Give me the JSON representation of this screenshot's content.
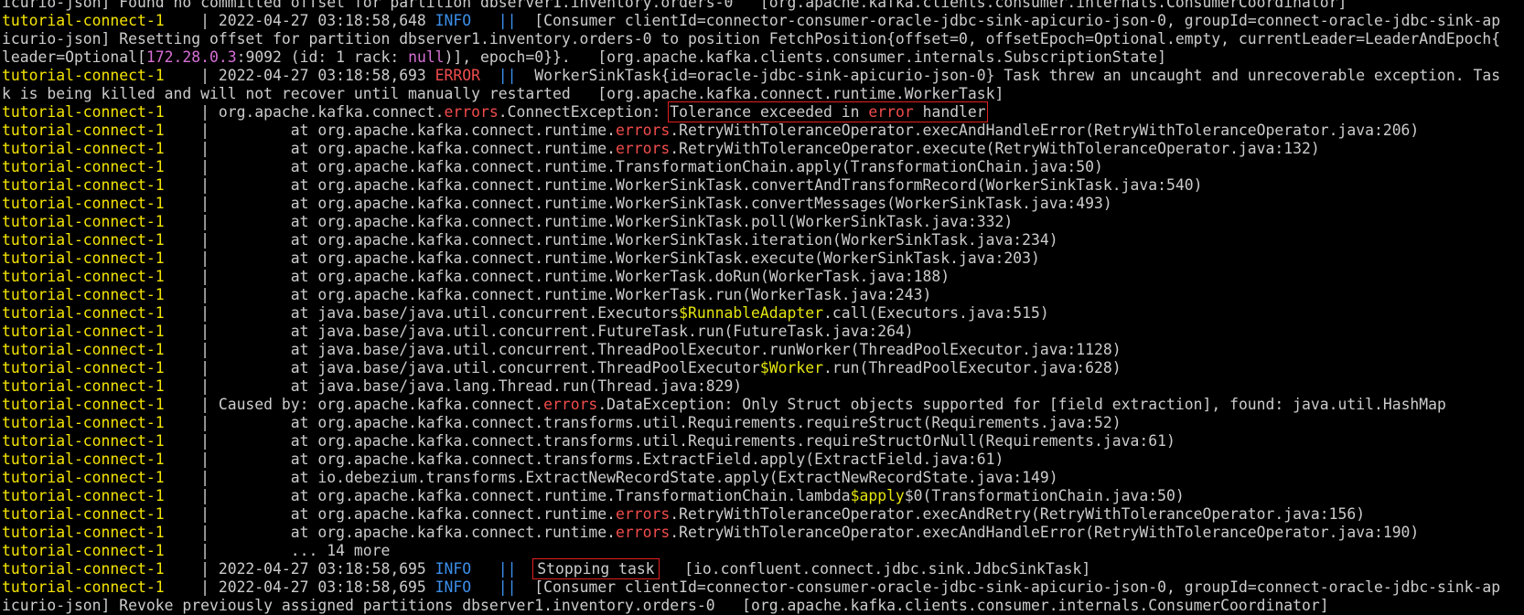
{
  "terminal": {
    "colors": {
      "background": "#000000",
      "text": "#cccccc",
      "container_prefix": "#f5e400",
      "info": "#3b8eea",
      "error": "#f14c4c",
      "magenta": "#d670d6",
      "class_yellow": "#e5e510",
      "highlight_box": "#e02020"
    },
    "lines": [
      {
        "segs": [
          {
            "t": "icurio-json] Found no committed offset for partition dbserver1.inventory.orders-0   [org.apache.kafka.clients.consumer.internals.ConsumerCoordinator]",
            "c": "default"
          }
        ]
      },
      {
        "segs": [
          {
            "t": "tutorial-connect-1",
            "c": "container"
          },
          {
            "t": "    | 2022-04-27 03:18:58,648 ",
            "c": "default"
          },
          {
            "t": "INFO",
            "c": "info"
          },
          {
            "t": "   ",
            "c": "default"
          },
          {
            "t": "||",
            "c": "info"
          },
          {
            "t": "  [Consumer clientId=connector-consumer-oracle-jdbc-sink-apicurio-json-0, groupId=connect-oracle-jdbc-sink-ap",
            "c": "default"
          }
        ]
      },
      {
        "segs": [
          {
            "t": "icurio-json] Resetting offset for partition dbserver1.inventory.orders-0 to position FetchPosition{offset=0, offsetEpoch=Optional.empty, currentLeader=LeaderAndEpoch{",
            "c": "default"
          }
        ]
      },
      {
        "segs": [
          {
            "t": "leader=Optional[",
            "c": "default"
          },
          {
            "t": "172.28.0.3",
            "c": "magenta"
          },
          {
            "t": ":9092 (id: 1 rack: ",
            "c": "default"
          },
          {
            "t": "null",
            "c": "magenta"
          },
          {
            "t": ")], epoch=0}}.   [org.apache.kafka.clients.consumer.internals.SubscriptionState]",
            "c": "default"
          }
        ]
      },
      {
        "segs": [
          {
            "t": "tutorial-connect-1",
            "c": "container"
          },
          {
            "t": "    | 2022-04-27 03:18:58,693 ",
            "c": "default"
          },
          {
            "t": "ERROR",
            "c": "error"
          },
          {
            "t": "  ",
            "c": "default"
          },
          {
            "t": "||",
            "c": "info"
          },
          {
            "t": "  WorkerSinkTask{id=oracle-jdbc-sink-apicurio-json-0} Task threw an uncaught and unrecoverable exception. Tas",
            "c": "default"
          }
        ]
      },
      {
        "segs": [
          {
            "t": "k is being killed and will not recover until manually restarted   [org.apache.kafka.connect.runtime.WorkerTask]",
            "c": "default"
          }
        ]
      },
      {
        "segs": [
          {
            "t": "tutorial-connect-1",
            "c": "container"
          },
          {
            "t": "    | org.apache.kafka.connect.",
            "c": "default"
          },
          {
            "t": "errors",
            "c": "errword"
          },
          {
            "t": ".ConnectException: ",
            "c": "default"
          },
          {
            "t": "Tolerance exceeded in ",
            "c": "default",
            "hl": "start",
            "hn": "tolerance-exceeded-highlight"
          },
          {
            "t": "error",
            "c": "errword",
            "hl": "mid"
          },
          {
            "t": " handler",
            "c": "default",
            "hl": "end"
          }
        ]
      },
      {
        "segs": [
          {
            "t": "tutorial-connect-1",
            "c": "container"
          },
          {
            "t": "    |         at org.apache.kafka.connect.runtime.",
            "c": "default"
          },
          {
            "t": "errors",
            "c": "errword"
          },
          {
            "t": ".RetryWithToleranceOperator.execAndHandleError(RetryWithToleranceOperator.java:206)",
            "c": "default"
          }
        ]
      },
      {
        "segs": [
          {
            "t": "tutorial-connect-1",
            "c": "container"
          },
          {
            "t": "    |         at org.apache.kafka.connect.runtime.",
            "c": "default"
          },
          {
            "t": "errors",
            "c": "errword"
          },
          {
            "t": ".RetryWithToleranceOperator.execute(RetryWithToleranceOperator.java:132)",
            "c": "default"
          }
        ]
      },
      {
        "segs": [
          {
            "t": "tutorial-connect-1",
            "c": "container"
          },
          {
            "t": "    |         at org.apache.kafka.connect.runtime.TransformationChain.apply(TransformationChain.java:50)",
            "c": "default"
          }
        ]
      },
      {
        "segs": [
          {
            "t": "tutorial-connect-1",
            "c": "container"
          },
          {
            "t": "    |         at org.apache.kafka.connect.runtime.WorkerSinkTask.convertAndTransformRecord(WorkerSinkTask.java:540)",
            "c": "default"
          }
        ]
      },
      {
        "segs": [
          {
            "t": "tutorial-connect-1",
            "c": "container"
          },
          {
            "t": "    |         at org.apache.kafka.connect.runtime.WorkerSinkTask.convertMessages(WorkerSinkTask.java:493)",
            "c": "default"
          }
        ]
      },
      {
        "segs": [
          {
            "t": "tutorial-connect-1",
            "c": "container"
          },
          {
            "t": "    |         at org.apache.kafka.connect.runtime.WorkerSinkTask.poll(WorkerSinkTask.java:332)",
            "c": "default"
          }
        ]
      },
      {
        "segs": [
          {
            "t": "tutorial-connect-1",
            "c": "container"
          },
          {
            "t": "    |         at org.apache.kafka.connect.runtime.WorkerSinkTask.iteration(WorkerSinkTask.java:234)",
            "c": "default"
          }
        ]
      },
      {
        "segs": [
          {
            "t": "tutorial-connect-1",
            "c": "container"
          },
          {
            "t": "    |         at org.apache.kafka.connect.runtime.WorkerSinkTask.execute(WorkerSinkTask.java:203)",
            "c": "default"
          }
        ]
      },
      {
        "segs": [
          {
            "t": "tutorial-connect-1",
            "c": "container"
          },
          {
            "t": "    |         at org.apache.kafka.connect.runtime.WorkerTask.doRun(WorkerTask.java:188)",
            "c": "default"
          }
        ]
      },
      {
        "segs": [
          {
            "t": "tutorial-connect-1",
            "c": "container"
          },
          {
            "t": "    |         at org.apache.kafka.connect.runtime.WorkerTask.run(WorkerTask.java:243)",
            "c": "default"
          }
        ]
      },
      {
        "segs": [
          {
            "t": "tutorial-connect-1",
            "c": "container"
          },
          {
            "t": "    |         at java.base/java.util.concurrent.Executors",
            "c": "default"
          },
          {
            "t": "$RunnableAdapter",
            "c": "yellow"
          },
          {
            "t": ".call(Executors.java:515)",
            "c": "default"
          }
        ]
      },
      {
        "segs": [
          {
            "t": "tutorial-connect-1",
            "c": "container"
          },
          {
            "t": "    |         at java.base/java.util.concurrent.FutureTask.run(FutureTask.java:264)",
            "c": "default"
          }
        ]
      },
      {
        "segs": [
          {
            "t": "tutorial-connect-1",
            "c": "container"
          },
          {
            "t": "    |         at java.base/java.util.concurrent.ThreadPoolExecutor.runWorker(ThreadPoolExecutor.java:1128)",
            "c": "default"
          }
        ]
      },
      {
        "segs": [
          {
            "t": "tutorial-connect-1",
            "c": "container"
          },
          {
            "t": "    |         at java.base/java.util.concurrent.ThreadPoolExecutor",
            "c": "default"
          },
          {
            "t": "$Worker",
            "c": "yellow"
          },
          {
            "t": ".run(ThreadPoolExecutor.java:628)",
            "c": "default"
          }
        ]
      },
      {
        "segs": [
          {
            "t": "tutorial-connect-1",
            "c": "container"
          },
          {
            "t": "    |         at java.base/java.lang.Thread.run(Thread.java:829)",
            "c": "default"
          }
        ]
      },
      {
        "segs": [
          {
            "t": "tutorial-connect-1",
            "c": "container"
          },
          {
            "t": "    | Caused by: org.apache.kafka.connect.",
            "c": "default"
          },
          {
            "t": "errors",
            "c": "errword"
          },
          {
            "t": ".DataException: Only Struct objects supported for [field extraction], found: java.util.HashMap",
            "c": "default"
          }
        ]
      },
      {
        "segs": [
          {
            "t": "tutorial-connect-1",
            "c": "container"
          },
          {
            "t": "    |         at org.apache.kafka.connect.transforms.util.Requirements.requireStruct(Requirements.java:52)",
            "c": "default"
          }
        ]
      },
      {
        "segs": [
          {
            "t": "tutorial-connect-1",
            "c": "container"
          },
          {
            "t": "    |         at org.apache.kafka.connect.transforms.util.Requirements.requireStructOrNull(Requirements.java:61)",
            "c": "default"
          }
        ]
      },
      {
        "segs": [
          {
            "t": "tutorial-connect-1",
            "c": "container"
          },
          {
            "t": "    |         at org.apache.kafka.connect.transforms.ExtractField.apply(ExtractField.java:61)",
            "c": "default"
          }
        ]
      },
      {
        "segs": [
          {
            "t": "tutorial-connect-1",
            "c": "container"
          },
          {
            "t": "    |         at io.debezium.transforms.ExtractNewRecordState.apply(ExtractNewRecordState.java:149)",
            "c": "default"
          }
        ]
      },
      {
        "segs": [
          {
            "t": "tutorial-connect-1",
            "c": "container"
          },
          {
            "t": "    |         at org.apache.kafka.connect.runtime.TransformationChain.lambda",
            "c": "default"
          },
          {
            "t": "$apply",
            "c": "yellow"
          },
          {
            "t": "$0(TransformationChain.java:50)",
            "c": "default"
          }
        ]
      },
      {
        "segs": [
          {
            "t": "tutorial-connect-1",
            "c": "container"
          },
          {
            "t": "    |         at org.apache.kafka.connect.runtime.",
            "c": "default"
          },
          {
            "t": "errors",
            "c": "errword"
          },
          {
            "t": ".RetryWithToleranceOperator.execAndRetry(RetryWithToleranceOperator.java:156)",
            "c": "default"
          }
        ]
      },
      {
        "segs": [
          {
            "t": "tutorial-connect-1",
            "c": "container"
          },
          {
            "t": "    |         at org.apache.kafka.connect.runtime.",
            "c": "default"
          },
          {
            "t": "errors",
            "c": "errword"
          },
          {
            "t": ".RetryWithToleranceOperator.execAndHandleError(RetryWithToleranceOperator.java:190)",
            "c": "default"
          }
        ]
      },
      {
        "segs": [
          {
            "t": "tutorial-connect-1",
            "c": "container"
          },
          {
            "t": "    |         ... 14 more",
            "c": "default"
          }
        ]
      },
      {
        "segs": [
          {
            "t": "tutorial-connect-1",
            "c": "container"
          },
          {
            "t": "    | 2022-04-27 03:18:58,695 ",
            "c": "default"
          },
          {
            "t": "INFO",
            "c": "info"
          },
          {
            "t": "   ",
            "c": "default"
          },
          {
            "t": "||",
            "c": "info"
          },
          {
            "t": "  ",
            "c": "default"
          },
          {
            "t": "Stopping task",
            "c": "default",
            "hl": "single",
            "hn": "stopping-task-highlight"
          },
          {
            "t": "   [io.confluent.connect.jdbc.sink.JdbcSinkTask]",
            "c": "default"
          }
        ]
      },
      {
        "segs": [
          {
            "t": "tutorial-connect-1",
            "c": "container"
          },
          {
            "t": "    | 2022-04-27 03:18:58,695 ",
            "c": "default"
          },
          {
            "t": "INFO",
            "c": "info"
          },
          {
            "t": "   ",
            "c": "default"
          },
          {
            "t": "||",
            "c": "info"
          },
          {
            "t": "  [Consumer clientId=connector-consumer-oracle-jdbc-sink-apicurio-json-0, groupId=connect-oracle-jdbc-sink-ap",
            "c": "default"
          }
        ]
      },
      {
        "segs": [
          {
            "t": "icurio-json] Revoke previously assigned partitions dbserver1.inventory.orders-0   [org.apache.kafka.clients.consumer.internals.ConsumerCoordinator]",
            "c": "default"
          }
        ]
      }
    ]
  }
}
